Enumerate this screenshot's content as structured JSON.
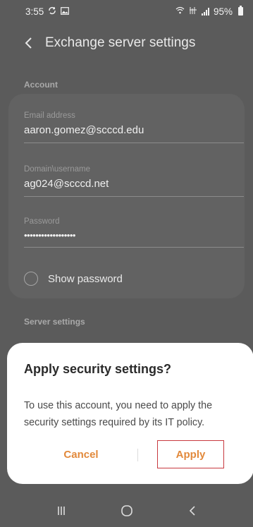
{
  "status_bar": {
    "time": "3:55",
    "battery": "95%"
  },
  "header": {
    "title": "Exchange server settings"
  },
  "account_section": {
    "label": "Account",
    "fields": [
      {
        "label": "Email address",
        "value": "aaron.gomez@scccd.edu"
      },
      {
        "label": "Domain\\username",
        "value": "ag024@scccd.net"
      },
      {
        "label": "Password",
        "value": "••••••••••••••••••"
      }
    ],
    "show_password_label": "Show password"
  },
  "server_section": {
    "label": "Server settings"
  },
  "dialog": {
    "title": "Apply security settings?",
    "message": "To use this account, you need to apply the security settings required by its IT policy.",
    "cancel_label": "Cancel",
    "apply_label": "Apply"
  },
  "colors": {
    "accent": "#e2893b",
    "highlight_border": "#c8393f"
  }
}
